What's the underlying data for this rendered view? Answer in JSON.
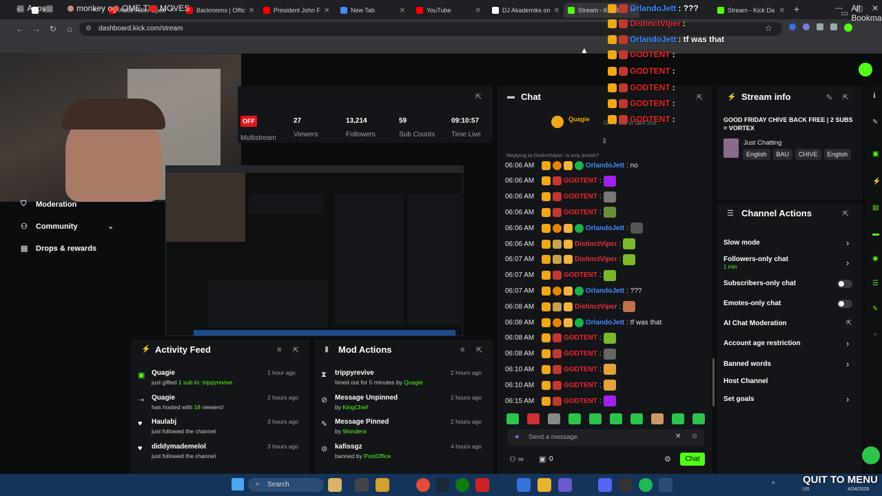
{
  "browser": {
    "tabs": [
      {
        "label": "X",
        "icon": "x-logo-icon"
      },
      {
        "label": "Adolf Hitler Spee",
        "icon": "youtube-icon"
      },
      {
        "label": "Backrooms | Offic",
        "icon": "youtube-icon"
      },
      {
        "label": "President John F",
        "icon": "youtube-icon"
      },
      {
        "label": "New Tab",
        "icon": "chrome-icon"
      },
      {
        "label": "YouTube",
        "icon": "youtube-icon"
      },
      {
        "label": "DJ Akademiks on",
        "icon": "x-logo-icon"
      },
      {
        "label": "Stream - Kick Da",
        "icon": "kick-icon"
      },
      {
        "label": "Stream - Kick Da",
        "icon": "kick-icon"
      }
    ],
    "url": "dashboard.kick.com/stream",
    "bookmarks": [
      "Apps",
      "monkey og",
      "OME.TV",
      "MOVES"
    ],
    "all_bookmarks": "All Bookmarks"
  },
  "sidebar": {
    "items": [
      {
        "label": "Moderation",
        "icon": "shield-icon"
      },
      {
        "label": "Community",
        "icon": "people-icon"
      },
      {
        "label": "Drops & rewards",
        "icon": "gift-icon"
      }
    ]
  },
  "stream_stats": {
    "status": "OFF",
    "multistream": "Multistream",
    "viewers": {
      "value": "27",
      "label": "Viewers"
    },
    "followers": {
      "value": "13,214",
      "label": "Followers"
    },
    "subs": {
      "value": "59",
      "label": "Sub Counts"
    },
    "time": {
      "value": "09:10:57",
      "label": "Time Live"
    }
  },
  "chat": {
    "title": "Chat",
    "pinned_user": "Quagie",
    "pinned_text": "Gift 1 sub to take 2nd",
    "reply_note": "Replying to DistinctViper: is only jewish?",
    "messages": [
      {
        "time": "06:06 AM",
        "user": "OrlandoJett",
        "cls": "u-orl",
        "badges": [
          "b-crown",
          "b-orange",
          "b-gift",
          "b-verify"
        ],
        "text": ": no",
        "emote": ""
      },
      {
        "time": "06:06 AM",
        "user": "GODTENT",
        "cls": "u-god",
        "badges": [
          "b-crown",
          "b-sub"
        ],
        "text": ":",
        "emote": "#a020f0"
      },
      {
        "time": "06:06 AM",
        "user": "GODTENT",
        "cls": "u-god",
        "badges": [
          "b-crown",
          "b-sub"
        ],
        "text": ":",
        "emote": "#777777"
      },
      {
        "time": "06:06 AM",
        "user": "GODTENT",
        "cls": "u-god",
        "badges": [
          "b-crown",
          "b-sub"
        ],
        "text": ":",
        "emote": "#6b8f3a"
      },
      {
        "time": "06:06 AM",
        "user": "OrlandoJett",
        "cls": "u-orl",
        "badges": [
          "b-crown",
          "b-orange",
          "b-gift",
          "b-verify"
        ],
        "text": ":",
        "emote": "#555555"
      },
      {
        "time": "06:06 AM",
        "user": "DistinctViper",
        "cls": "u-dist",
        "badges": [
          "b-crown",
          "b-kc",
          "b-gift"
        ],
        "text": ":",
        "emote": "#7bb82a"
      },
      {
        "time": "06:07 AM",
        "user": "DistinctViper",
        "cls": "u-dist",
        "badges": [
          "b-crown",
          "b-kc",
          "b-gift"
        ],
        "text": ":",
        "emote": "#7bb82a"
      },
      {
        "time": "06:07 AM",
        "user": "GODTENT",
        "cls": "u-god",
        "badges": [
          "b-crown",
          "b-sub"
        ],
        "text": ":",
        "emote": "#7bb82a"
      },
      {
        "time": "06:07 AM",
        "user": "OrlandoJett",
        "cls": "u-orl",
        "badges": [
          "b-crown",
          "b-orange",
          "b-gift",
          "b-verify"
        ],
        "text": ": ???",
        "emote": ""
      },
      {
        "time": "06:08 AM",
        "user": "DistinctViper",
        "cls": "u-dist",
        "badges": [
          "b-crown",
          "b-kc",
          "b-gift"
        ],
        "text": ":",
        "emote": "#c0704a"
      },
      {
        "time": "06:08 AM",
        "user": "OrlandoJett",
        "cls": "u-orl",
        "badges": [
          "b-crown",
          "b-orange",
          "b-gift",
          "b-verify"
        ],
        "text": ": tf was that",
        "emote": ""
      },
      {
        "time": "06:08 AM",
        "user": "GODTENT",
        "cls": "u-god",
        "badges": [
          "b-crown",
          "b-sub"
        ],
        "text": ":",
        "emote": "#7bb82a"
      },
      {
        "time": "06:08 AM",
        "user": "GODTENT",
        "cls": "u-god",
        "badges": [
          "b-crown",
          "b-sub"
        ],
        "text": ":",
        "emote": "#666666"
      },
      {
        "time": "06:10 AM",
        "user": "GODTENT",
        "cls": "u-god",
        "badges": [
          "b-crown",
          "b-sub"
        ],
        "text": ":",
        "emote": "#e3a23a"
      },
      {
        "time": "06:10 AM",
        "user": "GODTENT",
        "cls": "u-god",
        "badges": [
          "b-crown",
          "b-sub"
        ],
        "text": ":",
        "emote": "#e3a23a"
      },
      {
        "time": "06:15 AM",
        "user": "GODTENT",
        "cls": "u-god",
        "badges": [
          "b-crown",
          "b-sub"
        ],
        "text": ":",
        "emote": "#a020f0"
      }
    ],
    "input_placeholder": "Send a message",
    "count": "0",
    "send_label": "Chat"
  },
  "overlay_chat": [
    {
      "user": "OrlandoJett",
      "cls": "u-orl",
      "text": ": ???"
    },
    {
      "user": "DistinctViper",
      "cls": "u-dist",
      "text": ":"
    },
    {
      "user": "OrlandoJett",
      "cls": "u-orl",
      "text": ": tf was that"
    },
    {
      "user": "GODTENT",
      "cls": "u-god",
      "text": ":"
    },
    {
      "user": "GODTENT",
      "cls": "u-god",
      "text": ":"
    },
    {
      "user": "GODTENT",
      "cls": "u-god",
      "text": ":"
    },
    {
      "user": "GODTENT",
      "cls": "u-god",
      "text": ":"
    },
    {
      "user": "GODTENT",
      "cls": "u-god",
      "text": ":"
    }
  ],
  "stream_info": {
    "title": "Stream info",
    "stream_title": "GOOD FRIDAY CHIVE BACK FREE | 2 SUBS = VORTEX",
    "category": "Just Chatting",
    "tags": [
      "English",
      "BAU",
      "CHIVE",
      "English"
    ]
  },
  "channel_actions": {
    "title": "Channel Actions",
    "items": [
      {
        "label": "Slow mode",
        "control": "chevron"
      },
      {
        "label": "Followers-only chat",
        "sub": "1 min",
        "control": "chevron"
      },
      {
        "label": "Subscribers-only chat",
        "control": "toggle"
      },
      {
        "label": "Emotes-only chat",
        "control": "toggle"
      },
      {
        "label": "AI Chat Moderation",
        "control": "external"
      },
      {
        "label": "Account age restriction",
        "control": "chevron"
      },
      {
        "label": "Banned words",
        "control": "chevron"
      },
      {
        "label": "Host Channel",
        "control": "none"
      },
      {
        "label": "Set goals",
        "control": "chevron"
      }
    ]
  },
  "activity_feed": {
    "title": "Activity Feed",
    "items": [
      {
        "name": "Quagie",
        "text_a": "just gifted ",
        "highlight": "1 sub to: trippyrevive",
        "text_b": "",
        "time": "1 hour ago"
      },
      {
        "name": "Quagie",
        "text_a": "has hosted with ",
        "highlight": "18",
        "text_b": " viewers!",
        "time": "2 hours ago"
      },
      {
        "name": "Haulabj",
        "text_a": "just followed the channel",
        "highlight": "",
        "text_b": "",
        "time": "3 hours ago"
      },
      {
        "name": "diddymademelol",
        "text_a": "just followed the channel",
        "highlight": "",
        "text_b": "",
        "time": "3 hours ago"
      }
    ]
  },
  "mod_actions": {
    "title": "Mod Actions",
    "items": [
      {
        "name": "trippyrevive",
        "text_a": "timed out for 5 minutes by ",
        "by": "Quagie",
        "time": "2 hours ago"
      },
      {
        "name": "Message Unpinned",
        "text_a": "by ",
        "by": "KingChief",
        "time": "2 hours ago"
      },
      {
        "name": "Message Pinned",
        "text_a": "by ",
        "by": "Wondera",
        "time": "2 hours ago"
      },
      {
        "name": "kafissgz",
        "text_a": "banned by ",
        "by": "PostOffice",
        "time": "4 hours ago"
      }
    ]
  },
  "taskbar": {
    "search": "Search",
    "overlay_text": "QUIT TO MENU",
    "time": "",
    "date": "4/04/2026",
    "lang": "US"
  },
  "colors": {
    "kick_green": "#53fc18",
    "panel": "#141518",
    "bg": "#0b0c0e"
  }
}
